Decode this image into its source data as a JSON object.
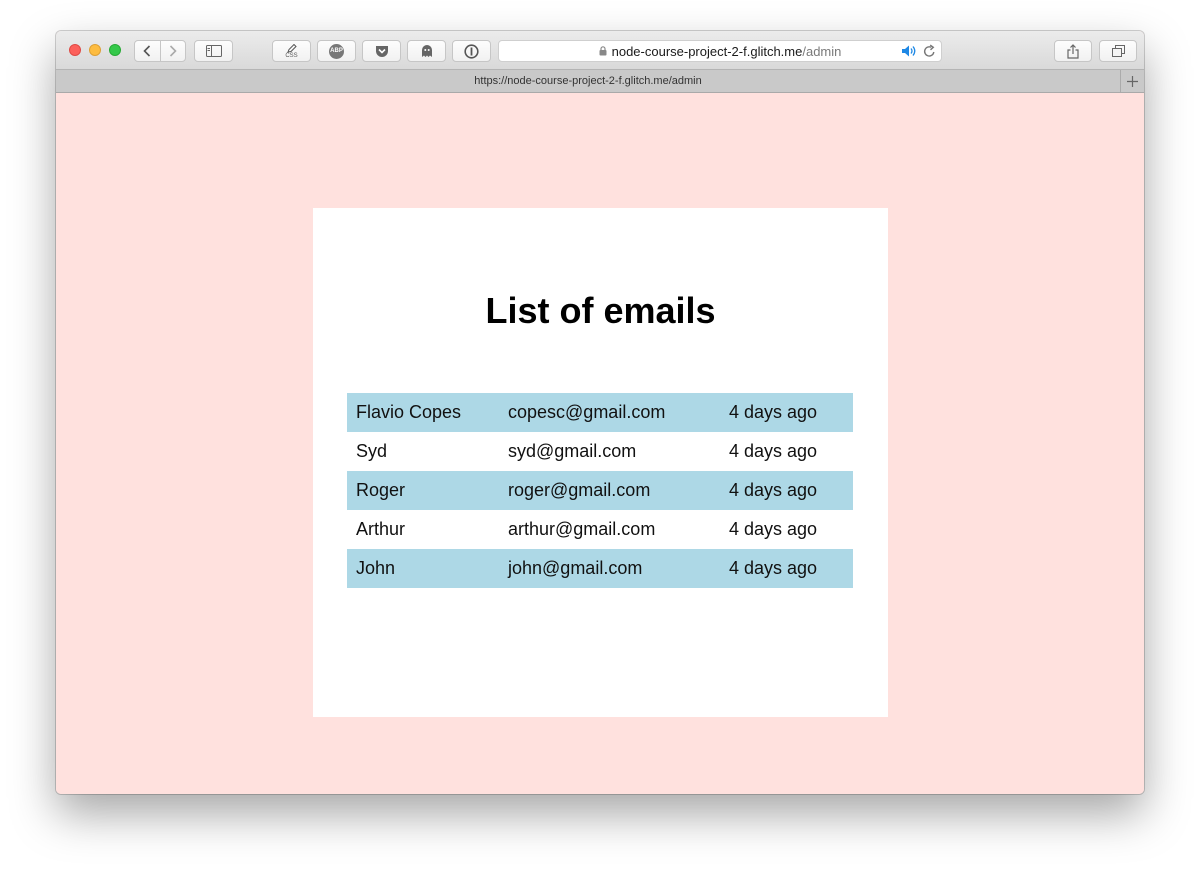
{
  "browser": {
    "url_domain": "node-course-project-2-f.glitch.me",
    "url_path": "/admin",
    "tab_title": "https://node-course-project-2-f.glitch.me/admin",
    "css_button_label": "CSS",
    "abp_label": "ABP"
  },
  "page": {
    "heading": "List of emails",
    "background_color": "#ffe1de",
    "stripe_color": "#add8e6",
    "rows": [
      {
        "name": "Flavio Copes",
        "email": "copesc@gmail.com",
        "time": "4 days ago"
      },
      {
        "name": "Syd",
        "email": "syd@gmail.com",
        "time": "4 days ago"
      },
      {
        "name": "Roger",
        "email": "roger@gmail.com",
        "time": "4 days ago"
      },
      {
        "name": "Arthur",
        "email": "arthur@gmail.com",
        "time": "4 days ago"
      },
      {
        "name": "John",
        "email": "john@gmail.com",
        "time": "4 days ago"
      }
    ]
  }
}
